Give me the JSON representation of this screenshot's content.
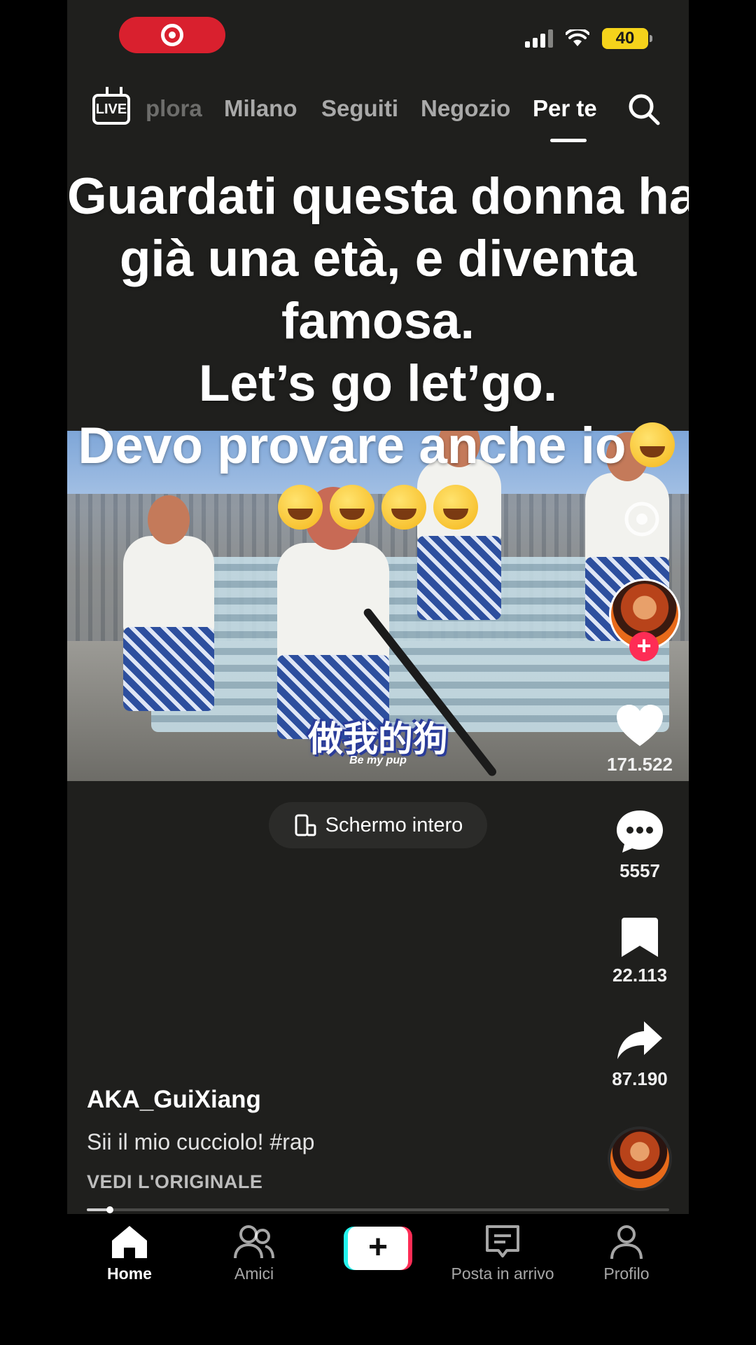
{
  "status_bar": {
    "battery": "40"
  },
  "top_nav": {
    "live_label": "LIVE",
    "tabs": [
      {
        "label": "plora",
        "active": false
      },
      {
        "label": "Milano",
        "active": false
      },
      {
        "label": "Seguiti",
        "active": false
      },
      {
        "label": "Negozio",
        "active": false
      },
      {
        "label": "Per te",
        "active": true
      }
    ]
  },
  "caption": {
    "lines": [
      "Guardati questa donna ha",
      "già una età, e diventa",
      "famosa.",
      "Let’s go let’go.",
      "Devo provare anche io"
    ]
  },
  "video": {
    "subtitle_cn": "做我的狗",
    "subtitle_en": "Be my pup"
  },
  "fullscreen_button": {
    "label": "Schermo intero"
  },
  "rail": {
    "likes": "171.522",
    "comments": "5557",
    "saves": "22.113",
    "shares": "87.190"
  },
  "post": {
    "author": "AKA_GuiXiang",
    "description": "Sii il mio cucciolo! #rap",
    "see_original": "VEDI L'ORIGINALE",
    "progress": 0.04
  },
  "bottom_nav": {
    "home": "Home",
    "friends": "Amici",
    "inbox": "Posta in arrivo",
    "profile": "Profilo"
  },
  "colors": {
    "accent": "#fe2c55",
    "cyan": "#25f4ee",
    "record": "#d9202e",
    "battery": "#f5d31b"
  }
}
